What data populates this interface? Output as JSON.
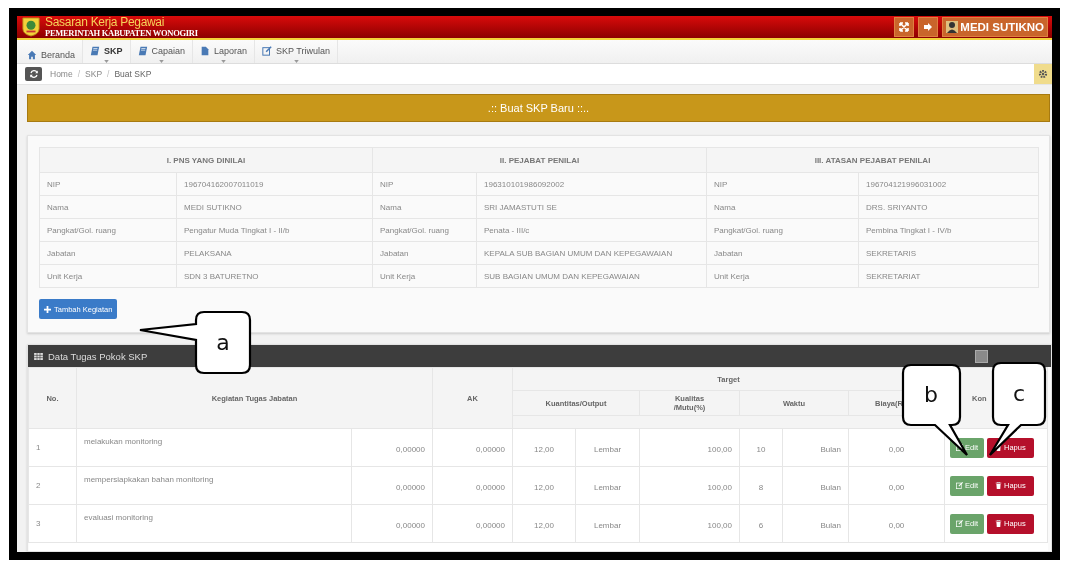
{
  "header": {
    "title": "Sasaran Kerja Pegawai",
    "subtitle": "PEMERINTAH KABUPATEN WONOGIRI",
    "user": "MEDI SUTIKNO"
  },
  "nav": [
    {
      "label": "Beranda",
      "kind": "home",
      "dropdown": false,
      "selected": false
    },
    {
      "label": "SKP",
      "kind": "book",
      "dropdown": true,
      "selected": true
    },
    {
      "label": "Capaian",
      "kind": "book",
      "dropdown": true,
      "selected": false
    },
    {
      "label": "Laporan",
      "kind": "file",
      "dropdown": true,
      "selected": false
    },
    {
      "label": "SKP Triwulan",
      "kind": "edit",
      "dropdown": true,
      "selected": false
    }
  ],
  "breadcrumb": {
    "separator": "/",
    "items": [
      "Home",
      "SKP",
      "Buat SKP"
    ]
  },
  "banner": ".:: Buat SKP Baru ::..",
  "info": [
    {
      "title": "I. PNS YANG DINILAI",
      "fields": [
        {
          "label": "NIP",
          "value": "196704162007011019"
        },
        {
          "label": "Nama",
          "value": "MEDI SUTIKNO"
        },
        {
          "label": "Pangkat/Gol. ruang",
          "value": "Pengatur Muda Tingkat I - II/b"
        },
        {
          "label": "Jabatan",
          "value": "PELAKSANA"
        },
        {
          "label": "Unit Kerja",
          "value": "SDN 3 BATURETNO"
        }
      ]
    },
    {
      "title": "II. PEJABAT PENILAI",
      "fields": [
        {
          "label": "NIP",
          "value": "196310101986092002"
        },
        {
          "label": "Nama",
          "value": "SRI JAMASTUTI SE"
        },
        {
          "label": "Pangkat/Gol. ruang",
          "value": "Penata - III/c"
        },
        {
          "label": "Jabatan",
          "value": "KEPALA SUB BAGIAN UMUM DAN KEPEGAWAIAN"
        },
        {
          "label": "Unit Kerja",
          "value": "SUB BAGIAN UMUM DAN KEPEGAWAIAN"
        }
      ]
    },
    {
      "title": "III. ATASAN PEJABAT PENILAI",
      "fields": [
        {
          "label": "NIP",
          "value": "196704121996031002"
        },
        {
          "label": "Nama",
          "value": "DRS. SRIYANTO"
        },
        {
          "label": "Pangkat/Gol. ruang",
          "value": "Pembina Tingkat I - IV/b"
        },
        {
          "label": "Jabatan",
          "value": "SEKRETARIS"
        },
        {
          "label": "Unit Kerja",
          "value": "SEKRETARIAT"
        }
      ]
    }
  ],
  "add_button": "Tambah Kegiatan",
  "tasks": {
    "title": "Data Tugas Pokok SKP",
    "headers": {
      "no": "No.",
      "activity": "Kegiatan Tugas Jabatan",
      "ak": "AK",
      "target": "Target",
      "quantity": "Kuantitas/Output",
      "quality": [
        "Kualitas",
        "/Mutu(%)"
      ],
      "time": "Waktu",
      "cost": "Biaya(R",
      "control": "Kon"
    },
    "rows": [
      {
        "no": "1",
        "activity": "melakukan monitoring",
        "ak_1": "0,00000",
        "ak_2": "0,00000",
        "quantity": "12,00",
        "unit": "Lembar",
        "quality": "100,00",
        "time": "10",
        "time_unit": "Bulan",
        "cost": "0,00",
        "edit": "Edit",
        "delete": "Hapus"
      },
      {
        "no": "2",
        "activity": "mempersiapkakan bahan monitoring",
        "ak_1": "0,00000",
        "ak_2": "0,00000",
        "quantity": "12,00",
        "unit": "Lembar",
        "quality": "100,00",
        "time": "8",
        "time_unit": "Bulan",
        "cost": "0,00",
        "edit": "Edit",
        "delete": "Hapus"
      },
      {
        "no": "3",
        "activity": "evaluasi monitoring",
        "ak_1": "0,00000",
        "ak_2": "0,00000",
        "quantity": "12,00",
        "unit": "Lembar",
        "quality": "100,00",
        "time": "6",
        "time_unit": "Bulan",
        "cost": "0,00",
        "edit": "Edit",
        "delete": "Hapus"
      }
    ]
  },
  "callouts": [
    {
      "label": "a"
    },
    {
      "label": "b"
    },
    {
      "label": "c"
    }
  ]
}
